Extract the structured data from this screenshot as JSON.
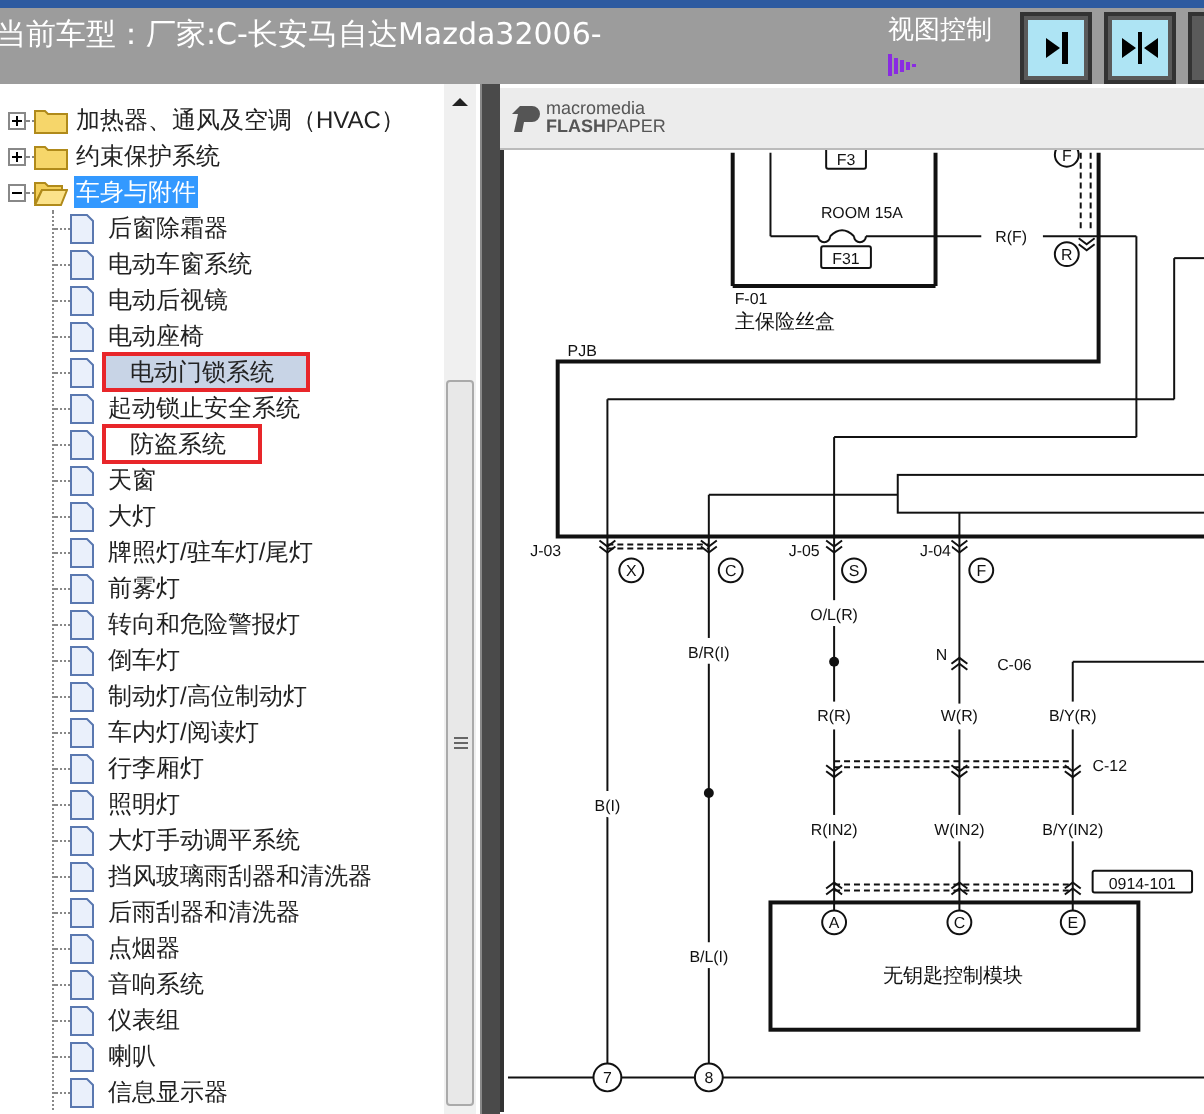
{
  "header": {
    "model_label": "当前车型：厂家:C-长安马自达Mazda32006-",
    "view_control": "视图控制"
  },
  "tree": [
    {
      "label": "加热器、通风及空调（HVAC）",
      "expanded": false,
      "selected": false
    },
    {
      "label": "约束保护系统",
      "expanded": false,
      "selected": false
    },
    {
      "label": "车身与附件",
      "expanded": true,
      "selected": true,
      "children": [
        {
          "label": "后窗除霜器",
          "selected": false,
          "highlighted": false
        },
        {
          "label": "电动车窗系统",
          "selected": false,
          "highlighted": false
        },
        {
          "label": "电动后视镜",
          "selected": false,
          "highlighted": false
        },
        {
          "label": "电动座椅",
          "selected": false,
          "highlighted": false
        },
        {
          "label": "电动门锁系统",
          "selected": true,
          "highlighted": true
        },
        {
          "label": "起动锁止安全系统",
          "selected": false,
          "highlighted": false
        },
        {
          "label": "防盗系统",
          "selected": false,
          "highlighted": true
        },
        {
          "label": "天窗",
          "selected": false,
          "highlighted": false
        },
        {
          "label": "大灯",
          "selected": false,
          "highlighted": false
        },
        {
          "label": "牌照灯/驻车灯/尾灯",
          "selected": false,
          "highlighted": false
        },
        {
          "label": "前雾灯",
          "selected": false,
          "highlighted": false
        },
        {
          "label": "转向和危险警报灯",
          "selected": false,
          "highlighted": false
        },
        {
          "label": "倒车灯",
          "selected": false,
          "highlighted": false
        },
        {
          "label": "制动灯/高位制动灯",
          "selected": false,
          "highlighted": false
        },
        {
          "label": "车内灯/阅读灯",
          "selected": false,
          "highlighted": false
        },
        {
          "label": "行李厢灯",
          "selected": false,
          "highlighted": false
        },
        {
          "label": "照明灯",
          "selected": false,
          "highlighted": false
        },
        {
          "label": "大灯手动调平系统",
          "selected": false,
          "highlighted": false
        },
        {
          "label": "挡风玻璃雨刮器和清洗器",
          "selected": false,
          "highlighted": false
        },
        {
          "label": "后雨刮器和清洗器",
          "selected": false,
          "highlighted": false
        },
        {
          "label": "点烟器",
          "selected": false,
          "highlighted": false
        },
        {
          "label": "音响系统",
          "selected": false,
          "highlighted": false
        },
        {
          "label": "仪表组",
          "selected": false,
          "highlighted": false
        },
        {
          "label": "喇叭",
          "selected": false,
          "highlighted": false
        },
        {
          "label": "信息显示器",
          "selected": false,
          "highlighted": false
        }
      ]
    }
  ],
  "viewer": {
    "logo_top": "macromedia",
    "logo_bottom": "**FLASH**PAPER"
  },
  "diagram": {
    "labels": [
      {
        "kind": "tag",
        "text": "F3"
      },
      {
        "kind": "text",
        "text": "ROOM 15A"
      },
      {
        "kind": "tag",
        "text": "F31"
      },
      {
        "kind": "text",
        "text": "R(F)"
      },
      {
        "kind": "pin",
        "text": "F"
      },
      {
        "kind": "pin",
        "text": "R"
      },
      {
        "kind": "text",
        "text": "F-01"
      },
      {
        "kind": "text",
        "text": "主保险丝盒"
      },
      {
        "kind": "text",
        "text": "PJB"
      },
      {
        "kind": "text",
        "text": "J-03"
      },
      {
        "kind": "pin",
        "text": "X"
      },
      {
        "kind": "pin",
        "text": "C"
      },
      {
        "kind": "text",
        "text": "J-05"
      },
      {
        "kind": "pin",
        "text": "S"
      },
      {
        "kind": "text",
        "text": "J-04"
      },
      {
        "kind": "pin",
        "text": "F"
      },
      {
        "kind": "text",
        "text": "O/L(R)"
      },
      {
        "kind": "text",
        "text": "B/R(I)"
      },
      {
        "kind": "text",
        "text": "N"
      },
      {
        "kind": "text",
        "text": "C-06"
      },
      {
        "kind": "text",
        "text": "R(R)"
      },
      {
        "kind": "text",
        "text": "W(R)"
      },
      {
        "kind": "text",
        "text": "B/Y(R)"
      },
      {
        "kind": "text",
        "text": "C-12"
      },
      {
        "kind": "text",
        "text": "B(I)"
      },
      {
        "kind": "text",
        "text": "R(IN2)"
      },
      {
        "kind": "text",
        "text": "W(IN2)"
      },
      {
        "kind": "text",
        "text": "B/Y(IN2)"
      },
      {
        "kind": "tag",
        "text": "0914-101"
      },
      {
        "kind": "pin",
        "text": "A"
      },
      {
        "kind": "pin",
        "text": "C"
      },
      {
        "kind": "pin",
        "text": "E"
      },
      {
        "kind": "text",
        "text": "无钥匙控制模块"
      },
      {
        "kind": "text",
        "text": "B/L(I)"
      },
      {
        "kind": "pin",
        "text": "7"
      },
      {
        "kind": "pin",
        "text": "8"
      }
    ]
  }
}
